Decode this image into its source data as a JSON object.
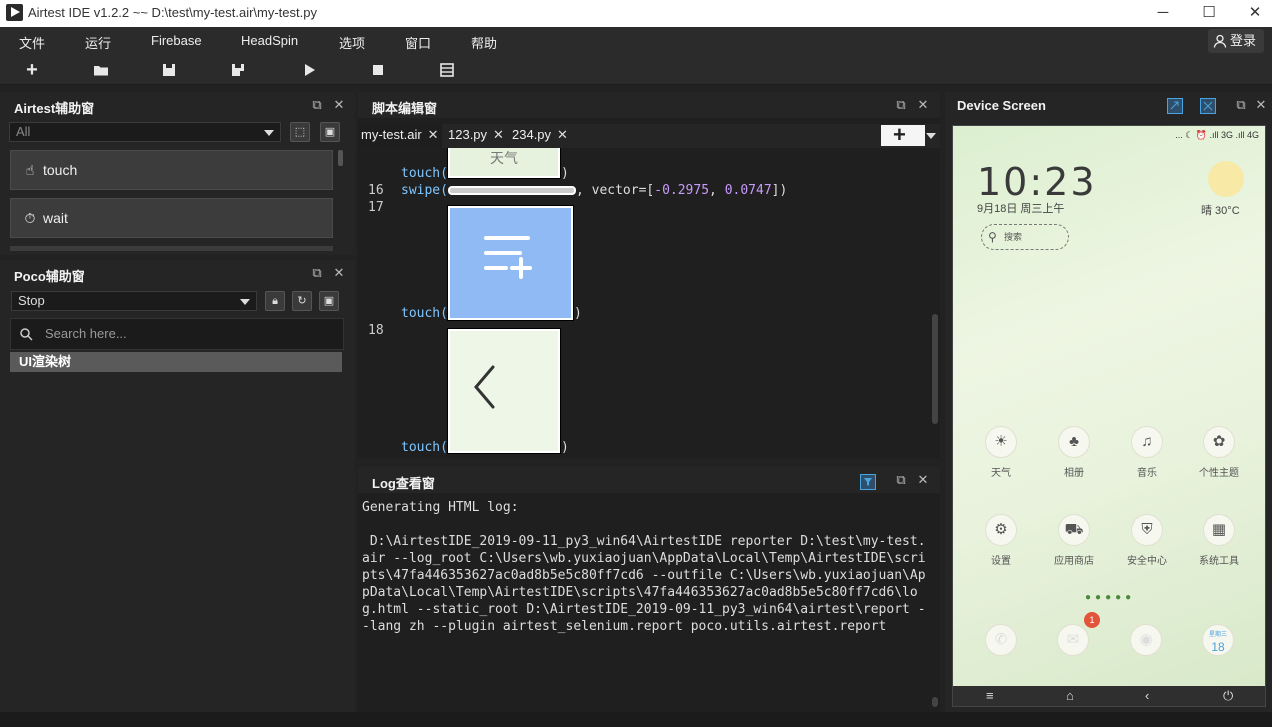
{
  "window": {
    "title": "Airtest IDE v1.2.2 ~~ D:\\test\\my-test.air\\my-test.py",
    "minimize": "─",
    "maximize": "☐",
    "close": "✕"
  },
  "menu": {
    "items": [
      "文件",
      "运行",
      "Firebase",
      "HeadSpin",
      "选项",
      "窗口",
      "帮助"
    ],
    "login": "登录"
  },
  "toolbar": {
    "icons": [
      "new-file-icon",
      "open-folder-icon",
      "save-icon",
      "save-as-icon",
      "run-icon",
      "stop-icon",
      "log-icon"
    ]
  },
  "airtest_panel": {
    "title": "Airtest辅助窗",
    "filter_value": "All",
    "buttons": [
      {
        "label": "touch",
        "icon": "hand-icon"
      },
      {
        "label": "wait",
        "icon": "clock-icon"
      }
    ]
  },
  "poco_panel": {
    "title": "Poco辅助窗",
    "mode_value": "Stop",
    "search_placeholder": "Search here...",
    "tree_root": "UI渲染树"
  },
  "editor": {
    "title": "脚本编辑窗",
    "tabs": [
      {
        "label": "my-test.air",
        "close": "✕"
      },
      {
        "label": "123.py",
        "close": "✕"
      },
      {
        "label": "234.py",
        "close": "✕"
      }
    ],
    "add_tab": "+",
    "lines": {
      "l15_fn": "touch(",
      "l15_close": ")",
      "l15_img_text": "天气",
      "l16_no": "16",
      "l16_fn": "swipe(",
      "l16_mid": ", vector=[",
      "l16_v1": "-0.2975",
      "l16_sep": ", ",
      "l16_v2": "0.0747",
      "l16_end": "])",
      "l17_no": "17",
      "l17_fn": "touch(",
      "l17_close": ")",
      "l18_no": "18",
      "l18_fn": "touch(",
      "l18_close": ")"
    }
  },
  "log": {
    "title": "Log查看窗",
    "text": "Generating HTML log:\n\n D:\\AirtestIDE_2019-09-11_py3_win64\\AirtestIDE reporter D:\\test\\my-test.air --log_root C:\\Users\\wb.yuxiaojuan\\AppData\\Local\\Temp\\AirtestIDE\\scripts\\47fa446353627ac0ad8b5e5c80ff7cd6 --outfile C:\\Users\\wb.yuxiaojuan\\AppData\\Local\\Temp\\AirtestIDE\\scripts\\47fa446353627ac0ad8b5e5c80ff7cd6\\log.html --static_root D:\\AirtestIDE_2019-09-11_py3_win64\\airtest\\report --lang zh --plugin airtest_selenium.report poco.utils.airtest.report"
  },
  "device": {
    "title": "Device Screen",
    "status": "... ☾ ⏰ .ıll 3G .ıll 4G",
    "clock": "10:23",
    "date": "9月18日 周三上午",
    "weather": "晴  30°C",
    "search": "搜索",
    "apps_row1": [
      "天气",
      "相册",
      "音乐",
      "个性主题"
    ],
    "apps_row2": [
      "设置",
      "应用商店",
      "安全中心",
      "系统工具"
    ],
    "dock_badge": "1",
    "dock_date_top": "星期三",
    "dock_date_num": "18"
  },
  "colors": {
    "bg": "#222222",
    "panel": "#252526",
    "keyword": "#7fc6ff",
    "number": "#c79bfa"
  }
}
